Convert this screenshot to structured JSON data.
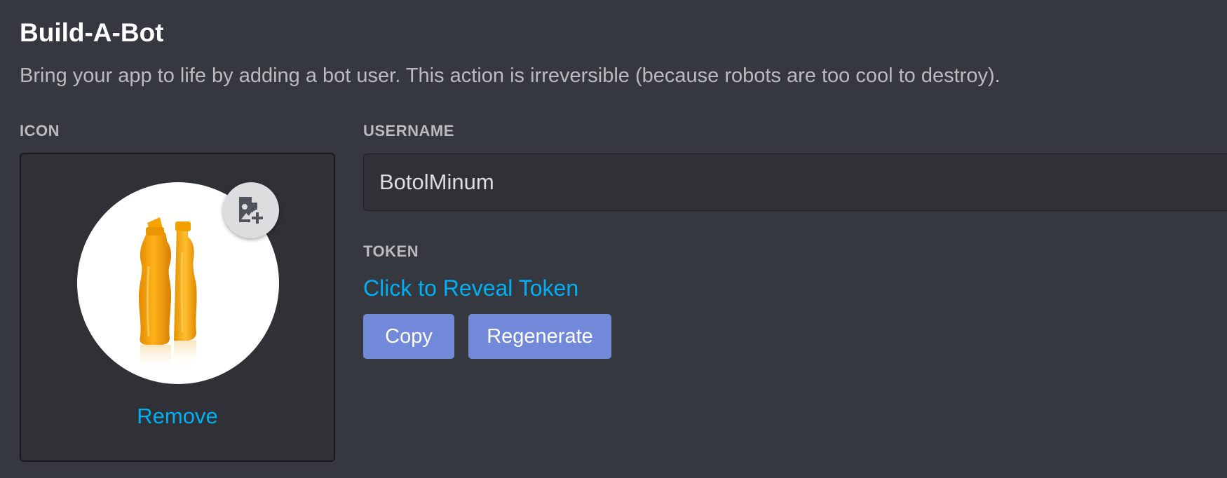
{
  "header": {
    "title": "Build-A-Bot",
    "subtitle": "Bring your app to life by adding a bot user. This action is irreversible (because robots are too cool to destroy)."
  },
  "icon_section": {
    "label": "ICON",
    "remove_label": "Remove",
    "upload_icon": "image-add-icon",
    "avatar_image": "orange-water-bottles"
  },
  "username_section": {
    "label": "USERNAME",
    "value": "BotolMinum"
  },
  "token_section": {
    "label": "TOKEN",
    "reveal_label": "Click to Reveal Token",
    "copy_label": "Copy",
    "regenerate_label": "Regenerate"
  },
  "colors": {
    "background": "#36383f",
    "panel": "#2f3136",
    "link": "#00b0f4",
    "button": "#7289da",
    "muted_text": "#b9bbbe"
  }
}
